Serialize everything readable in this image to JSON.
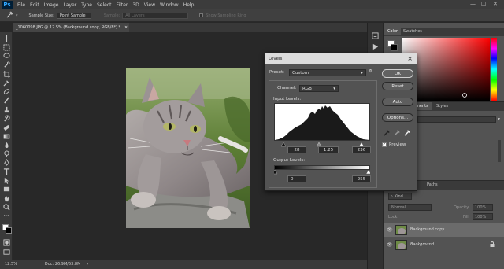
{
  "app": {
    "logo": "Ps"
  },
  "menu": [
    "File",
    "Edit",
    "Image",
    "Layer",
    "Type",
    "Select",
    "Filter",
    "3D",
    "View",
    "Window",
    "Help"
  ],
  "window_controls": [
    "—",
    "☐",
    "✕"
  ],
  "options_bar": {
    "sample_size_label": "Sample Size:",
    "sample_size_value": "Point Sample",
    "sample_label": "Sample:",
    "sample_value": "All Layers",
    "show_ring_label": "Show Sampling Ring"
  },
  "document": {
    "tab_title": "_1060098.JPG @ 12.5% (Background copy, RGB/8*) *",
    "tab_close": "✕"
  },
  "status": {
    "zoom": "12.5%",
    "doc": "Doc: 26.9M/53.8M"
  },
  "color_panel": {
    "tabs": [
      "Color",
      "Swatches"
    ],
    "accent_color": "#ff0000"
  },
  "adjust_panel": {
    "tabs": [
      "ments",
      "Styles"
    ]
  },
  "layers_panel": {
    "tabs": [
      "Paths"
    ],
    "kind_label": "Kind",
    "blend_mode": "Normal",
    "opacity_label": "Opacity:",
    "opacity_value": "100%",
    "lock_label": "Lock:",
    "fill_label": "Fill:",
    "fill_value": "100%",
    "layers": [
      {
        "name": "Background copy",
        "visible": true,
        "selected": true
      },
      {
        "name": "Background",
        "visible": true,
        "selected": false,
        "locked": true
      }
    ]
  },
  "levels_dialog": {
    "title": "Levels",
    "preset_label": "Preset:",
    "preset_value": "Custom",
    "channel_label": "Channel:",
    "channel_value": "RGB",
    "input_levels_label": "Input Levels:",
    "input_black": "28",
    "input_gamma": "1.25",
    "input_white": "236",
    "output_levels_label": "Output Levels:",
    "output_black": "0",
    "output_white": "255",
    "buttons": {
      "ok": "OK",
      "reset": "Reset",
      "auto": "Auto",
      "options": "Options..."
    },
    "preview_label": "Preview",
    "preview_checked": true
  }
}
